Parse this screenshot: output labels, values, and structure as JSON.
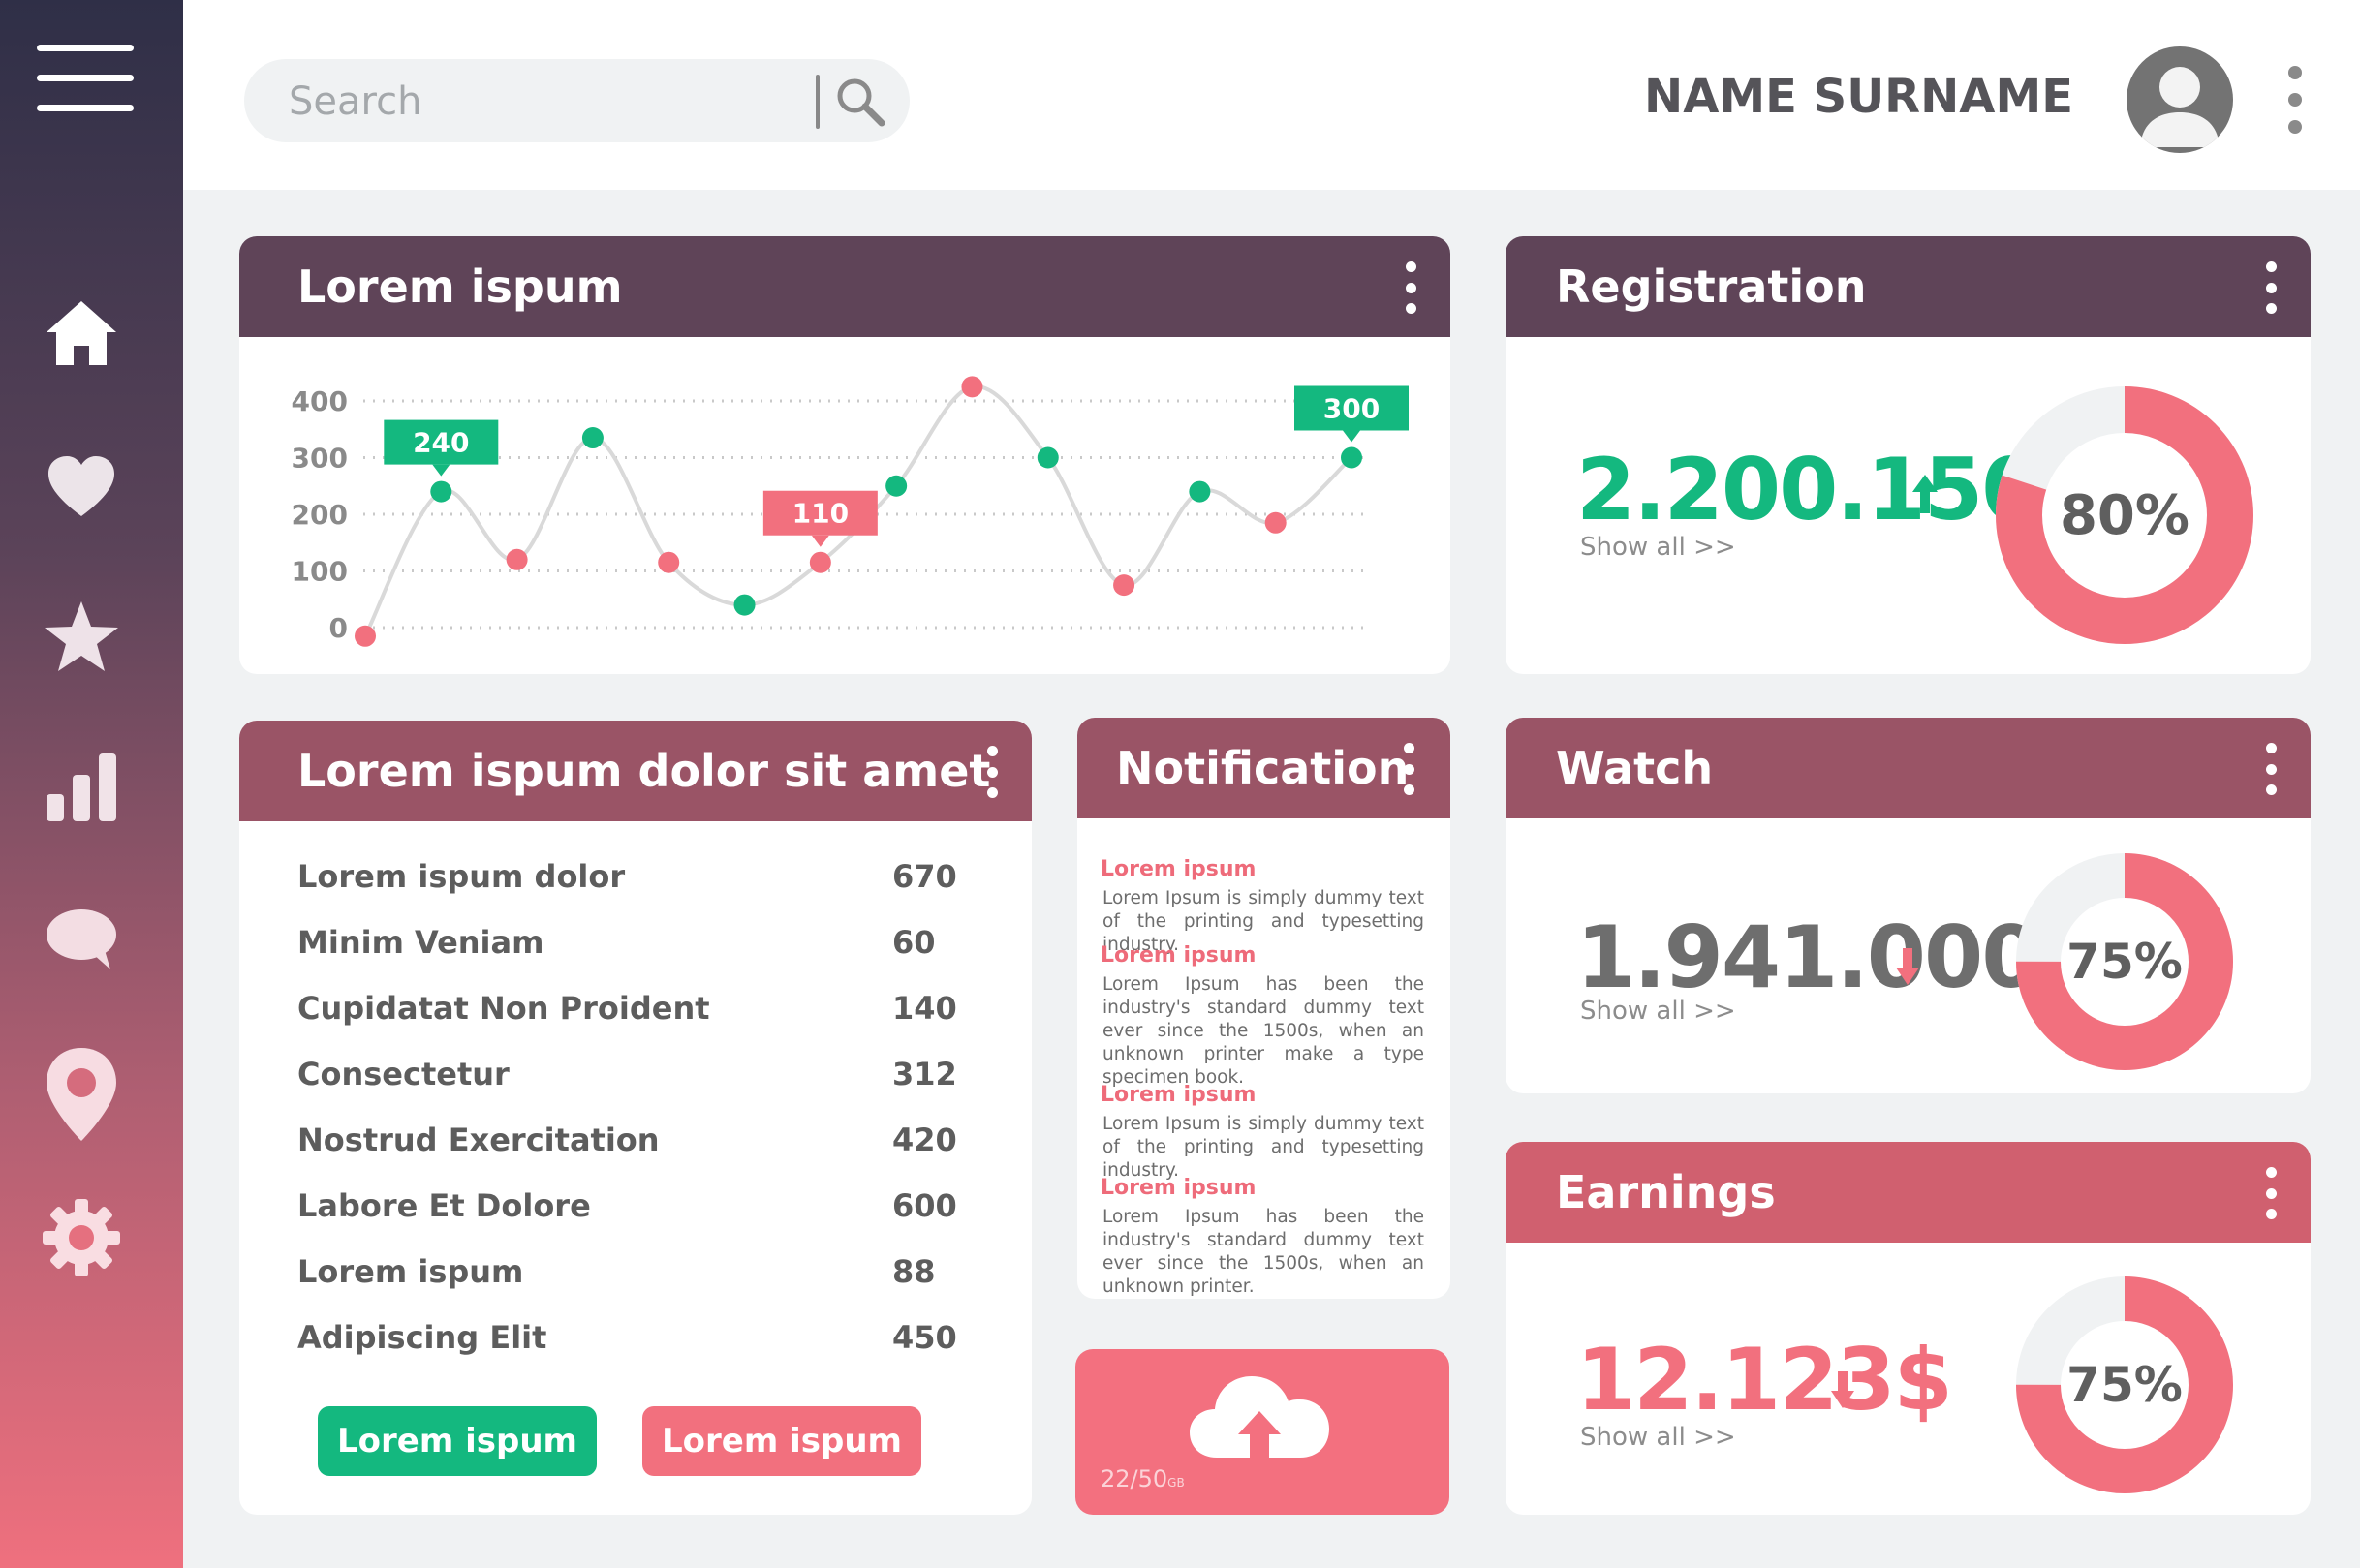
{
  "user": {
    "name": "NAME SURNAME"
  },
  "search": {
    "placeholder": "Search"
  },
  "sidebar": {
    "icons": [
      "menu-icon",
      "home-icon",
      "heart-icon",
      "star-icon",
      "bar-chart-icon",
      "chat-icon",
      "location-pin-icon",
      "gear-icon"
    ]
  },
  "colors": {
    "green": "#14b87f",
    "pink": "#f2707e",
    "dark_header": "#5f4458",
    "mid_header": "#9a5466",
    "earn_header": "#d0606f"
  },
  "chart_card": {
    "title": "Lorem ispum"
  },
  "chart_data": {
    "type": "line",
    "title": "Lorem ispum",
    "xlabel": "",
    "ylabel": "",
    "ylim": [
      0,
      400
    ],
    "yticks": [
      "400",
      "300",
      "200",
      "100",
      "0"
    ],
    "grid": true,
    "points": [
      {
        "y": -15,
        "marker": "pink"
      },
      {
        "y": 240,
        "marker": "green",
        "callout": "240"
      },
      {
        "y": 120,
        "marker": "pink"
      },
      {
        "y": 335,
        "marker": "green"
      },
      {
        "y": 115,
        "marker": "pink"
      },
      {
        "y": 40,
        "marker": "green"
      },
      {
        "y": 115,
        "marker": "pink",
        "callout": "110"
      },
      {
        "y": 250,
        "marker": "green"
      },
      {
        "y": 425,
        "marker": "pink"
      },
      {
        "y": 300,
        "marker": "green"
      },
      {
        "y": 75,
        "marker": "pink"
      },
      {
        "y": 240,
        "marker": "green"
      },
      {
        "y": 185,
        "marker": "pink"
      },
      {
        "y": 300,
        "marker": "green",
        "callout": "300"
      }
    ]
  },
  "registration": {
    "title": "Registration",
    "value": "2.200.150",
    "trend": "up",
    "show_all": "Show all  >>",
    "percent": 80,
    "percent_label": "80%"
  },
  "list_card": {
    "title": "Lorem ispum dolor sit amet",
    "rows": [
      {
        "label": "Lorem ispum dolor",
        "value": "670"
      },
      {
        "label": "Minim Veniam",
        "value": "60"
      },
      {
        "label": "Cupidatat Non Proident",
        "value": "140"
      },
      {
        "label": "Consectetur",
        "value": "312"
      },
      {
        "label": "Nostrud Exercitation",
        "value": "420"
      },
      {
        "label": "Labore Et Dolore",
        "value": "600"
      },
      {
        "label": "Lorem ispum",
        "value": "88"
      },
      {
        "label": "Adipiscing Elit",
        "value": "450"
      }
    ],
    "button_primary": "Lorem ispum",
    "button_secondary": "Lorem ispum"
  },
  "notification": {
    "title": "Notification",
    "items": [
      {
        "title": "Lorem ipsum",
        "body": "Lorem Ipsum is simply dummy text of the printing and typesetting industry."
      },
      {
        "title": "Lorem ipsum",
        "body": "Lorem Ipsum has been the industry's standard dummy text ever since the 1500s, when an unknown printer make a type specimen book."
      },
      {
        "title": "Lorem ipsum",
        "body": "Lorem Ipsum is simply dummy text of the printing and typesetting industry."
      },
      {
        "title": "Lorem ipsum",
        "body": "Lorem Ipsum has been the industry's standard dummy text ever since the 1500s, when an unknown printer."
      }
    ]
  },
  "upload": {
    "used": "22/50",
    "unit": "GB",
    "icon": "cloud-upload-icon"
  },
  "watch": {
    "title": "Watch",
    "value": "1.941.000",
    "trend": "down",
    "show_all": "Show all  >>",
    "percent": 75,
    "percent_label": "75%"
  },
  "earnings": {
    "title": "Earnings",
    "value": "12.123$",
    "trend": "down",
    "show_all": "Show all  >>",
    "percent": 75,
    "percent_label": "75%"
  }
}
